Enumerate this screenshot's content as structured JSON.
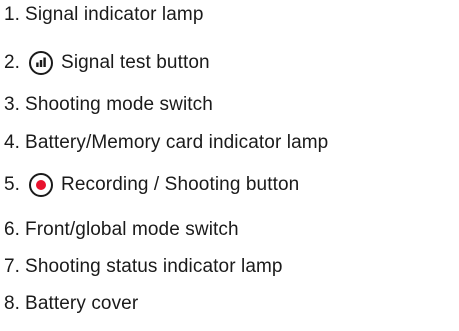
{
  "items": [
    {
      "number": "1.",
      "label": "Signal indicator lamp"
    },
    {
      "number": "2.",
      "label": "Signal test button",
      "icon": "signal-bars-icon"
    },
    {
      "number": "3.",
      "label": "Shooting mode switch"
    },
    {
      "number": "4.",
      "label": "Battery/Memory card indicator lamp"
    },
    {
      "number": "5.",
      "label": "Recording / Shooting button",
      "icon": "record-dot-icon"
    },
    {
      "number": "6.",
      "label": "Front/global mode switch"
    },
    {
      "number": "7.",
      "label": "Shooting status indicator lamp"
    },
    {
      "number": "8.",
      "label": "Battery cover"
    }
  ],
  "colors": {
    "text": "#1a1a1a",
    "record_dot": "#e8112d"
  }
}
